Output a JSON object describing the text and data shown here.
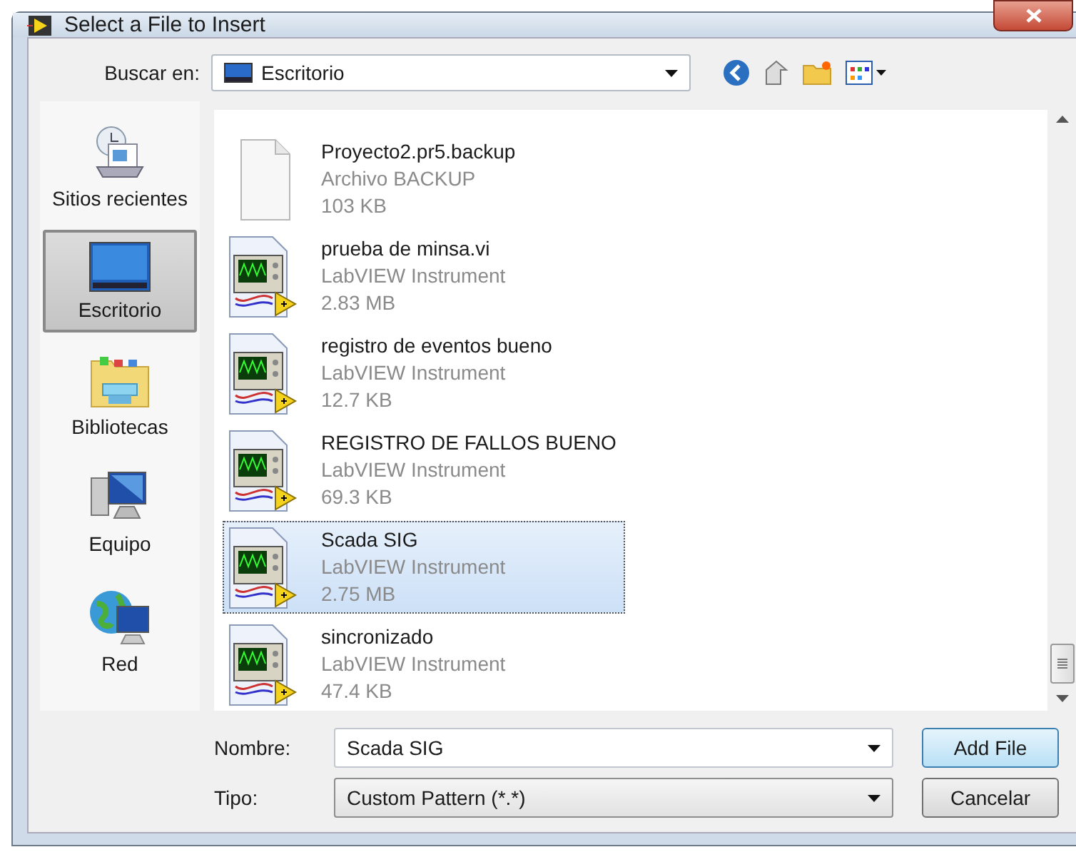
{
  "window": {
    "title": "Select a File to Insert"
  },
  "look_in": {
    "label": "Buscar en:",
    "value": "Escritorio"
  },
  "places": [
    {
      "kind": "recent",
      "label": "Sitios recientes",
      "selected": false
    },
    {
      "kind": "desktop",
      "label": "Escritorio",
      "selected": true
    },
    {
      "kind": "libraries",
      "label": "Bibliotecas",
      "selected": false
    },
    {
      "kind": "computer",
      "label": "Equipo",
      "selected": false
    },
    {
      "kind": "network",
      "label": "Red",
      "selected": false
    }
  ],
  "files": [
    {
      "kind": "backup",
      "name": "Proyecto2.pr5.backup",
      "type": "Archivo BACKUP",
      "size": "103 KB",
      "selected": false
    },
    {
      "kind": "vi",
      "name": "prueba de minsa.vi",
      "type": "LabVIEW Instrument",
      "size": "2.83 MB",
      "selected": false
    },
    {
      "kind": "vi",
      "name": "registro de eventos bueno",
      "type": "LabVIEW Instrument",
      "size": "12.7 KB",
      "selected": false
    },
    {
      "kind": "vi",
      "name": "REGISTRO DE FALLOS BUENO",
      "type": "LabVIEW Instrument",
      "size": "69.3 KB",
      "selected": false
    },
    {
      "kind": "vi",
      "name": "Scada SIG",
      "type": "LabVIEW Instrument",
      "size": "2.75 MB",
      "selected": true
    },
    {
      "kind": "vi",
      "name": "sincronizado",
      "type": "LabVIEW Instrument",
      "size": "47.4 KB",
      "selected": false
    }
  ],
  "file_name": {
    "label": "Nombre:",
    "value": "Scada SIG"
  },
  "file_type": {
    "label": "Tipo:",
    "value": "Custom Pattern (*.*)"
  },
  "buttons": [
    "Add File",
    "Cancelar"
  ]
}
